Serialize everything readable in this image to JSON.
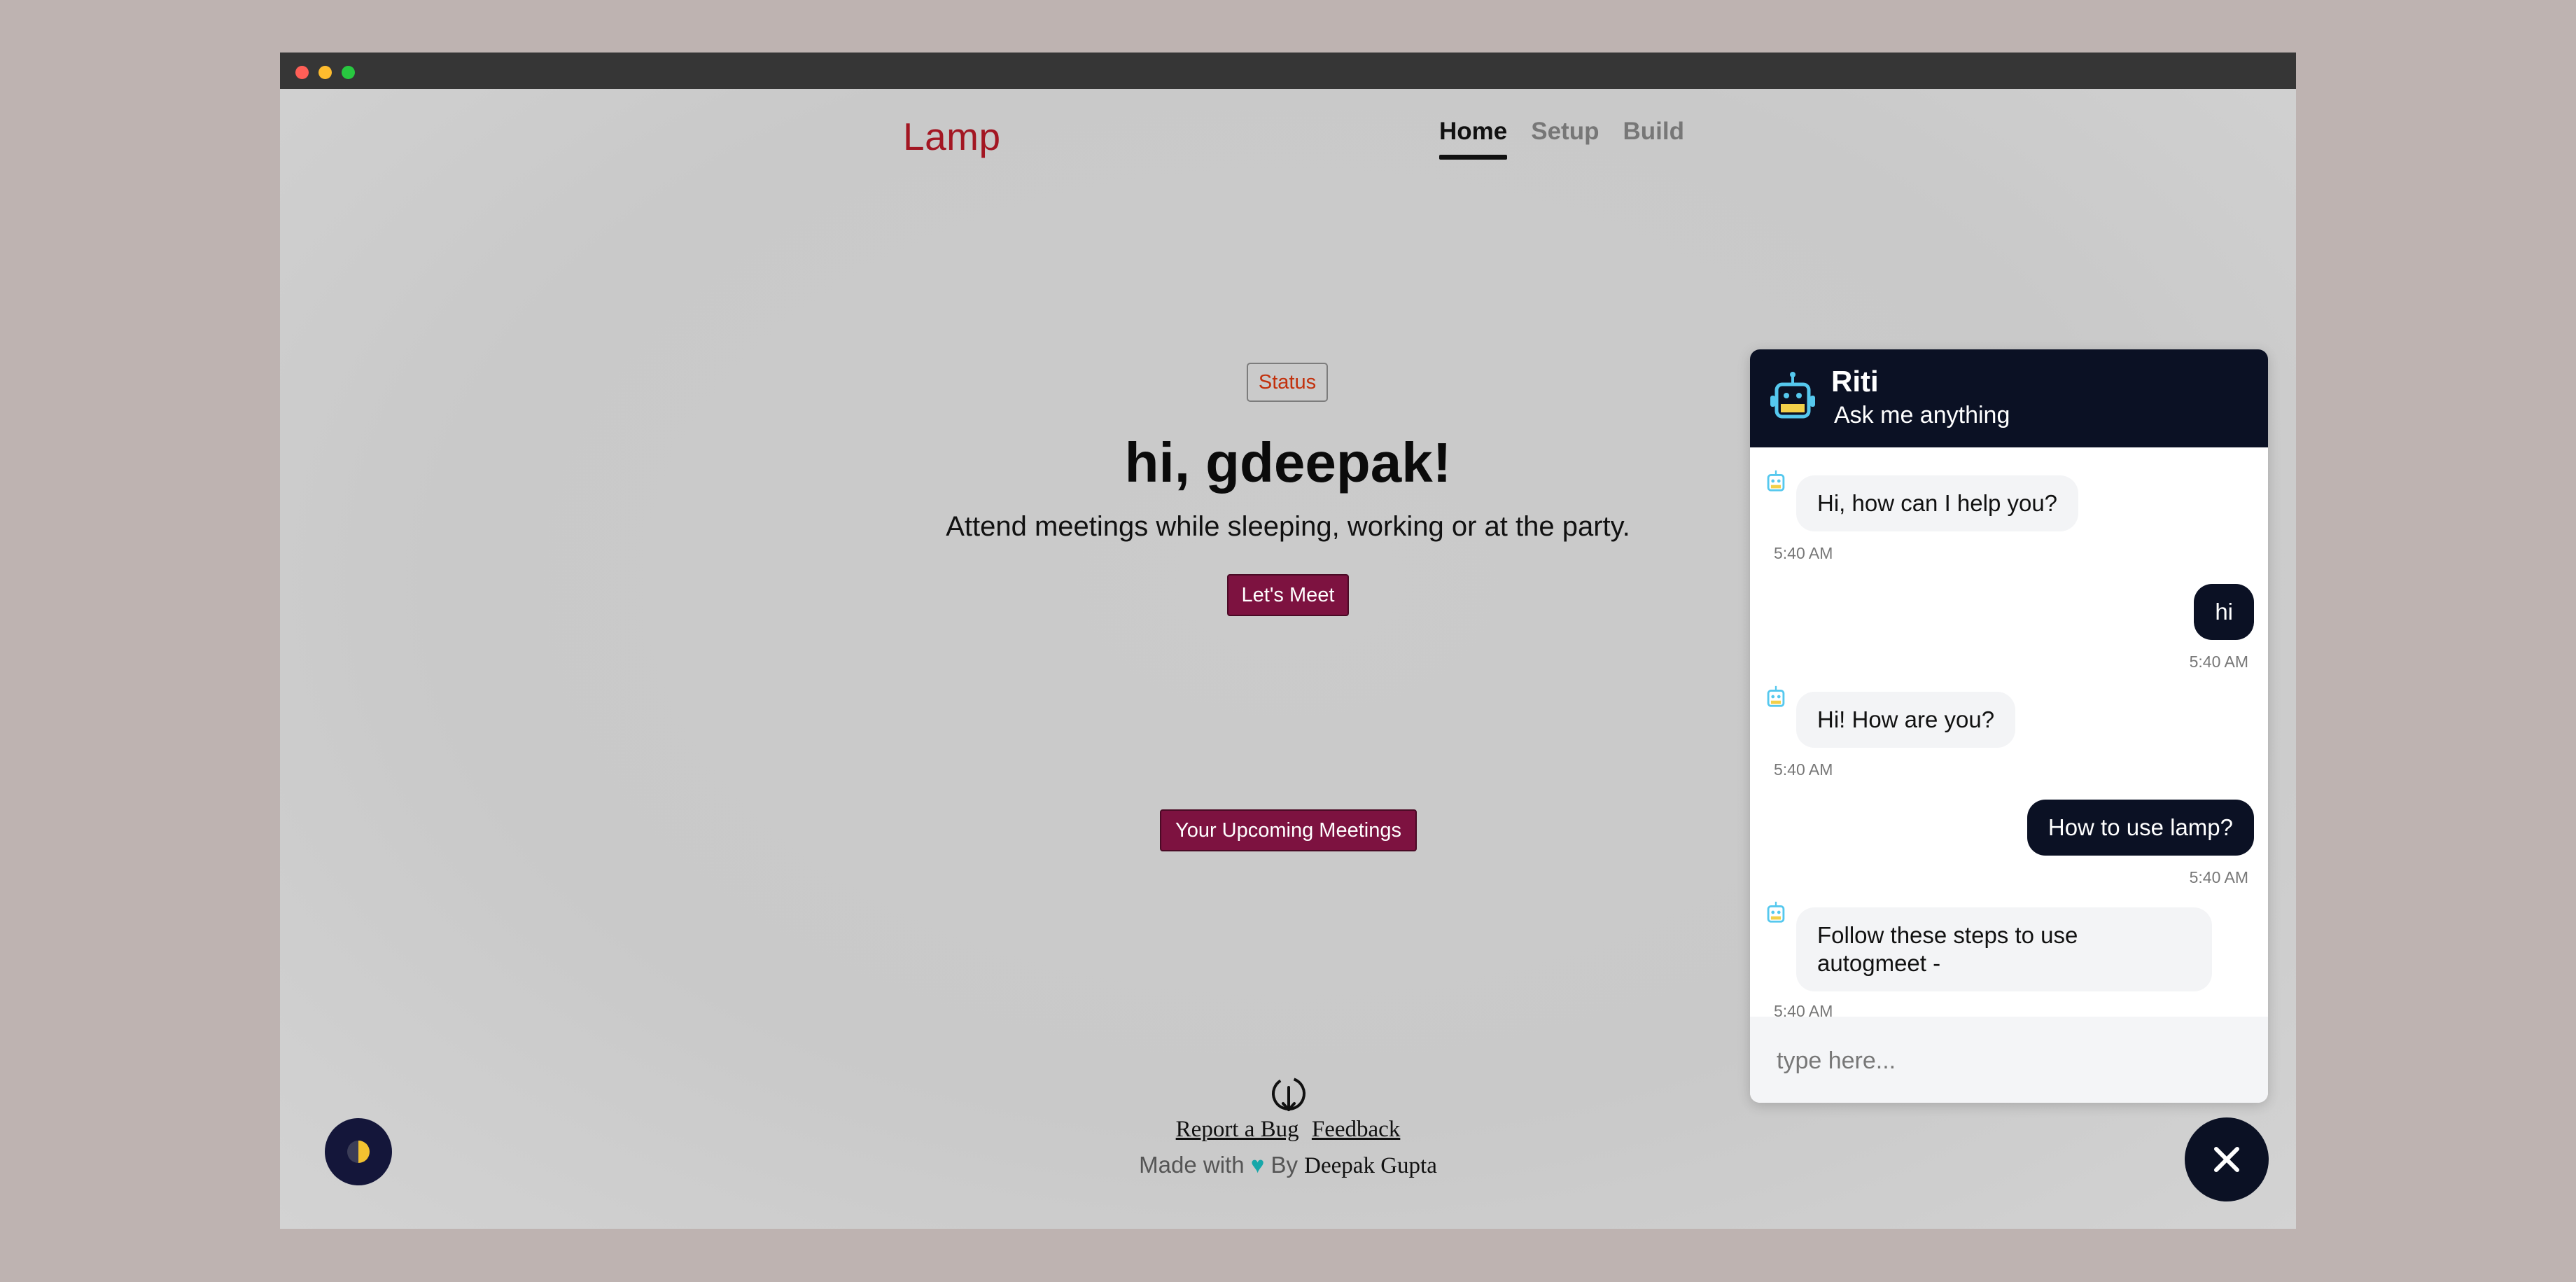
{
  "app": {
    "logo": "Lamp"
  },
  "nav": {
    "items": [
      {
        "label": "Home"
      },
      {
        "label": "Setup"
      },
      {
        "label": "Build"
      }
    ]
  },
  "hero": {
    "status": "Status",
    "title": "hi, gdeepak!",
    "subtitle": "Attend meetings while sleeping, working or at the party.",
    "meet_button": "Let's Meet",
    "upcoming_button": "Your Upcoming Meetings"
  },
  "footer": {
    "report_bug": "Report a Bug",
    "feedback": "Feedback",
    "made_with": "Made with",
    "heart": "♥",
    "by": "By",
    "author": "Deepak Gupta"
  },
  "chat": {
    "name": "Riti",
    "tagline": "Ask me anything",
    "messages": [
      {
        "from": "bot",
        "text": "Hi, how can I help you?",
        "time": "5:40 AM"
      },
      {
        "from": "user",
        "text": "hi",
        "time": "5:40 AM"
      },
      {
        "from": "bot",
        "text": "Hi! How are you?",
        "time": "5:40 AM"
      },
      {
        "from": "user",
        "text": "How to use lamp?",
        "time": "5:40 AM"
      },
      {
        "from": "bot",
        "text": "Follow these steps to use autogmeet -",
        "time": "5:40 AM"
      }
    ],
    "input_placeholder": "type here..."
  },
  "icons": {
    "bot": "robot-icon",
    "theme": "half-moon-icon",
    "close": "close-icon",
    "download": "download-circle-icon"
  },
  "colors": {
    "brand": "#a31622",
    "button": "#7d1240",
    "chat_dark": "#0b1124",
    "bot_icon": "#55c8ee",
    "status_text": "#c2310d",
    "heart": "#17a7a9"
  }
}
